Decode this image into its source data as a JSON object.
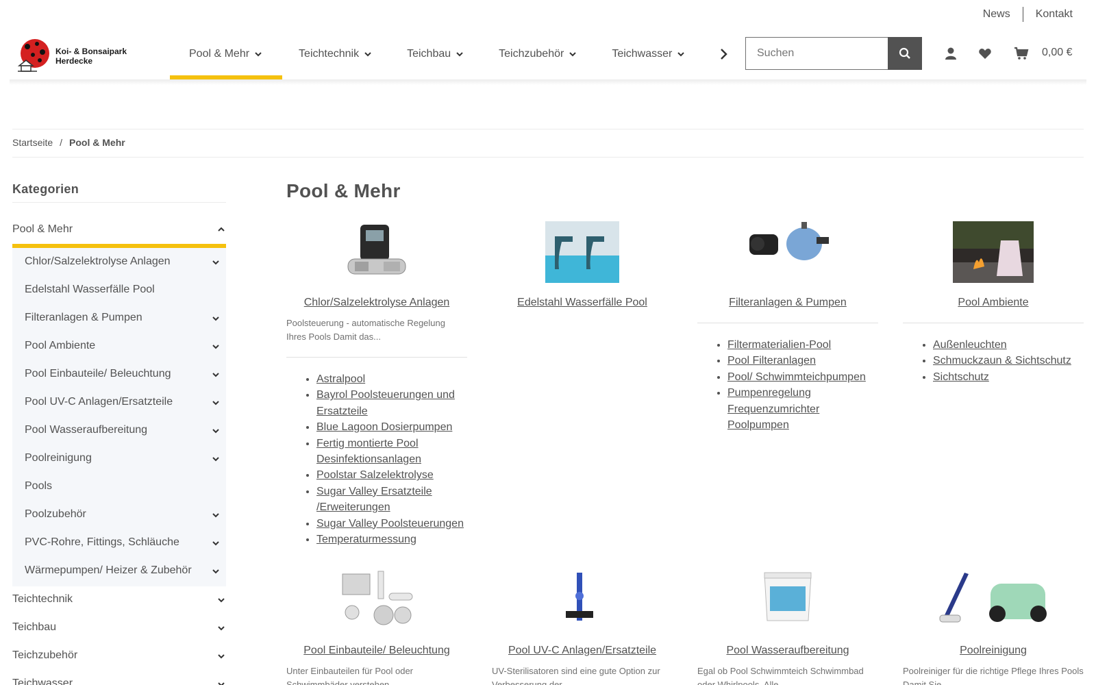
{
  "topbar": {
    "links": [
      "News",
      "Kontakt"
    ]
  },
  "logo": {
    "line1": "Koi- & Bonsaipark",
    "line2": "Herdecke"
  },
  "nav": {
    "items": [
      {
        "label": "Pool & Mehr",
        "active": true
      },
      {
        "label": "Teichtechnik"
      },
      {
        "label": "Teichbau"
      },
      {
        "label": "Teichzubehör"
      },
      {
        "label": "Teichwasser"
      }
    ],
    "accent": "#f5c10e"
  },
  "search": {
    "placeholder": "Suchen"
  },
  "header_icons": [
    "user-icon",
    "heart-icon",
    "cart-icon"
  ],
  "cart": {
    "total": "0,00 €"
  },
  "breadcrumb": {
    "home": "Startseite",
    "separator": "/",
    "current": "Pool & Mehr"
  },
  "sidebar": {
    "title": "Kategorien",
    "active": "Pool & Mehr",
    "subitems": [
      "Chlor/Salzelektrolyse Anlagen",
      "Edelstahl Wasserfälle Pool",
      "Filteranlagen & Pumpen",
      "Pool Ambiente",
      "Pool Einbauteile/ Beleuchtung",
      "Pool UV-C Anlagen/Ersatzteile",
      "Pool Wasseraufbereitung",
      "Poolreinigung",
      "Pools",
      "Poolzubehör",
      "PVC-Rohre, Fittings, Schläuche",
      "Wärmepumpen/ Heizer & Zubehör"
    ],
    "toplevel": [
      "Teichtechnik",
      "Teichbau",
      "Teichzubehör",
      "Teichwasser"
    ]
  },
  "main": {
    "title": "Pool & Mehr",
    "cards": [
      {
        "name": "Chlor/Salzelektrolyse Anlagen",
        "desc": "Poolsteuerung - automatische Regelung Ihres Pools Damit das...",
        "children": [
          "Astralpool",
          "Bayrol Poolsteuerungen und Ersatzteile",
          "Blue Lagoon Dosierpumpen",
          "Fertig montierte Pool Desinfektionsanlagen",
          "Poolstar Salzelektrolyse",
          "Sugar Valley Ersatzteile /Erweiterungen",
          "Sugar Valley Poolsteuerungen",
          "Temperaturmessung"
        ]
      },
      {
        "name": "Edelstahl Wasserfälle Pool"
      },
      {
        "name": "Filteranlagen & Pumpen",
        "children": [
          "Filtermaterialien-Pool",
          "Pool Filteranlagen",
          "Pool/ Schwimmteichpumpen",
          "Pumpenregelung Frequenzumrichter Poolpumpen"
        ]
      },
      {
        "name": "Pool Ambiente",
        "children": [
          "Außenleuchten",
          "Schmuckzaun & Sichtschutz",
          "Sichtschutz"
        ]
      },
      {
        "name": "Pool Einbauteile/ Beleuchtung",
        "desc": "Unter Einbauteilen für Pool oder Schwimmbäder verstehen"
      },
      {
        "name": "Pool UV-C Anlagen/Ersatzteile",
        "desc": "UV-Sterilisatoren sind eine gute Option zur Verbesserung der"
      },
      {
        "name": "Pool Wasseraufbereitung",
        "desc": "Egal ob Pool Schwimmteich Schwimmbad oder Whirlpools. Alle"
      },
      {
        "name": "Poolreinigung",
        "desc": "Poolreiniger für die richtige Pflege Ihres Pools Damit Sie"
      }
    ]
  }
}
